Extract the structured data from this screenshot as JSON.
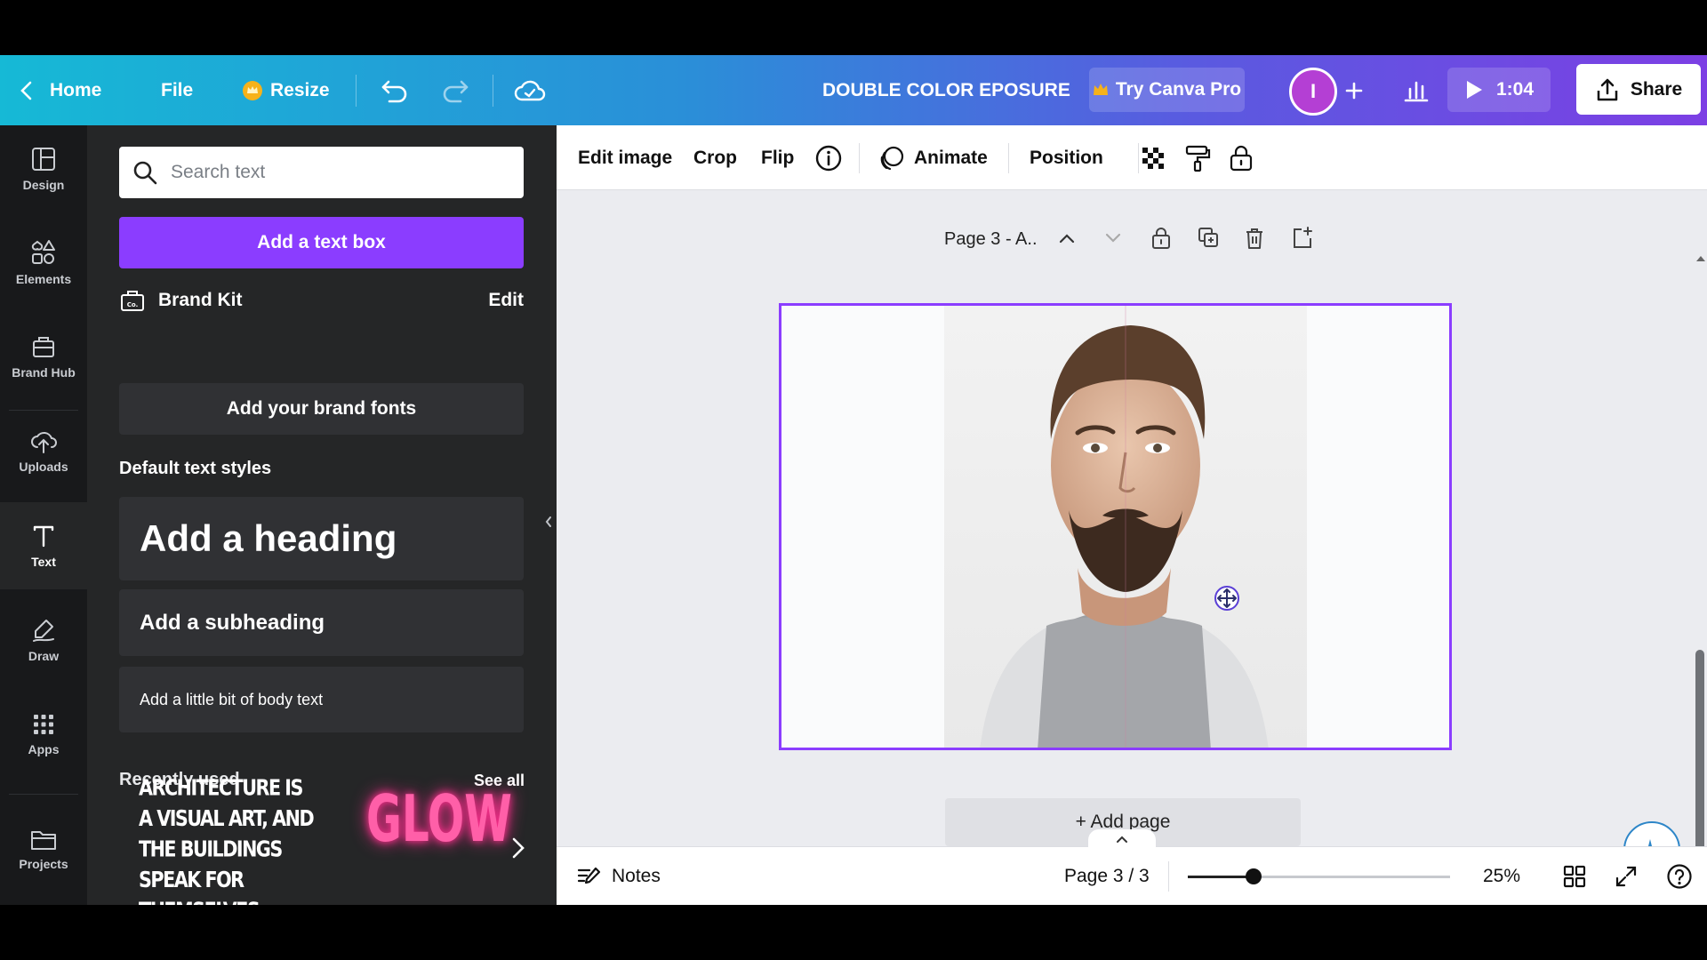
{
  "topbar": {
    "home_label": "Home",
    "file_label": "File",
    "resize_label": "Resize",
    "doc_title": "DOUBLE COLOR EPOSURE",
    "try_pro_label": "Try Canva Pro",
    "avatar_initial": "I",
    "present_time": "1:04",
    "share_label": "Share"
  },
  "rail": {
    "items": [
      {
        "label": "Design",
        "icon": "layout-icon"
      },
      {
        "label": "Elements",
        "icon": "shapes-icon"
      },
      {
        "label": "Brand Hub",
        "icon": "briefcase-icon"
      },
      {
        "label": "Uploads",
        "icon": "cloud-upload-icon"
      },
      {
        "label": "Text",
        "icon": "text-icon"
      },
      {
        "label": "Draw",
        "icon": "pen-icon"
      },
      {
        "label": "Apps",
        "icon": "grid-icon"
      },
      {
        "label": "Projects",
        "icon": "folder-icon"
      }
    ],
    "active": "Text"
  },
  "panel": {
    "search_placeholder": "Search text",
    "add_text_box": "Add a text box",
    "brand_kit_label": "Brand Kit",
    "brand_kit_edit": "Edit",
    "add_brand_fonts": "Add your brand fonts",
    "default_styles_title": "Default text styles",
    "heading": "Add a heading",
    "subheading": "Add a subheading",
    "body": "Add a little bit of body text",
    "recently_used_title": "Recently used",
    "see_all": "See all",
    "recent_items": [
      {
        "text": "ARCHITECTURE IS A VISUAL ART, AND THE BUILDINGS SPEAK FOR THEMSELVES."
      },
      {
        "text": "GLOW"
      }
    ]
  },
  "canvas_toolbar": {
    "edit_image": "Edit image",
    "crop": "Crop",
    "flip": "Flip",
    "animate": "Animate",
    "position": "Position"
  },
  "page": {
    "label": "Page 3 - A..",
    "add_page": "+ Add page"
  },
  "bottombar": {
    "notes": "Notes",
    "page_indicator": "Page 3 / 3",
    "zoom_percent": "25%",
    "zoom_fraction": 0.25
  },
  "colors": {
    "accent": "#8b3dff",
    "rail_bg": "#18191b",
    "panel_bg": "#252627",
    "glow": "#ff5fa8"
  }
}
